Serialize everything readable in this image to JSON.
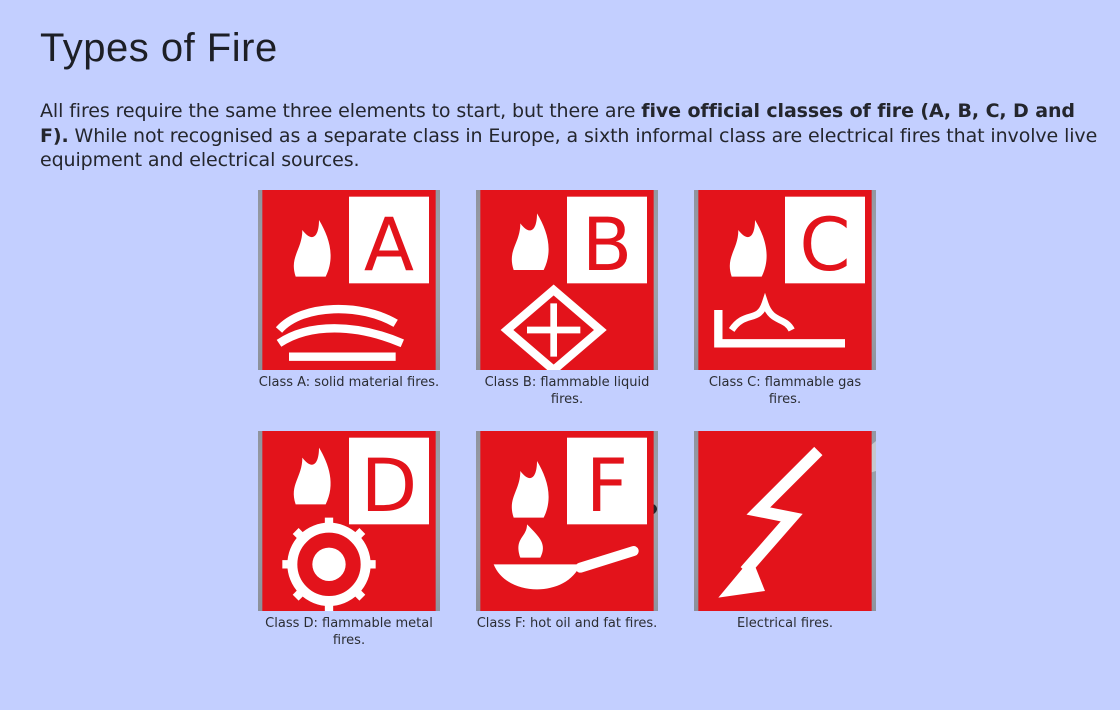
{
  "page": {
    "title": "Types of Fire",
    "intro_before": "All fires require the same three elements to start, but there are ",
    "intro_bold": "five official classes of fire (A, B, C, D and F).",
    "intro_after": " While not recognised as a separate class in Europe, a sixth informal class are electrical fires that involve live equipment and electrical sources."
  },
  "colors": {
    "background": "#c3cfff",
    "badge_red": "#e3131b",
    "flame_orange": "#f25c12",
    "flame_yellow": "#ffd21f"
  },
  "fire_classes": [
    {
      "letter": "A",
      "caption": "Class A: solid material fires.",
      "icon": "burning-logs-icon"
    },
    {
      "letter": "B",
      "caption": "Class B: flammable liquid fires.",
      "icon": "fuel-can-icon"
    },
    {
      "letter": "C",
      "caption": "Class C: flammable gas fires.",
      "icon": "gas-cylinder-icon"
    },
    {
      "letter": "D",
      "caption": "Class D: flammable metal fires.",
      "icon": "metal-ingot-icon"
    },
    {
      "letter": "F",
      "caption": "Class F: hot oil and fat fires.",
      "icon": "frying-pan-icon"
    },
    {
      "letter": "",
      "caption": "Electrical fires.",
      "icon": "electrical-socket-icon"
    }
  ]
}
